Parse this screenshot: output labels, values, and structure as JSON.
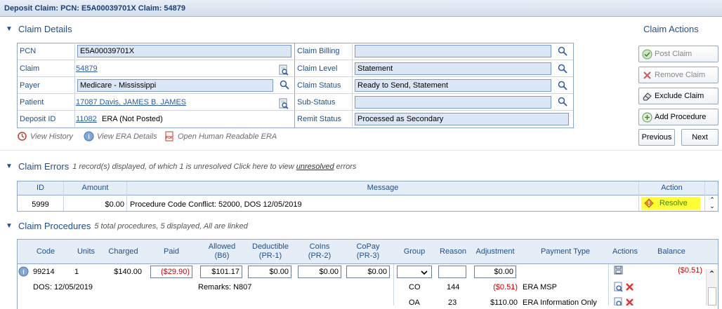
{
  "title": "Deposit Claim: PCN: E5A00039701X Claim: 54879",
  "claim_details": {
    "heading": "Claim Details",
    "left_rows": [
      {
        "label": "PCN",
        "value": "E5A00039701X"
      },
      {
        "label": "Claim",
        "value": "54879"
      },
      {
        "label": "Payer",
        "value": "Medicare - Mississippi"
      },
      {
        "label": "Patient",
        "value": "17087 Davis, JAMES B. JAMES"
      },
      {
        "label": "Deposit ID",
        "value": "11082",
        "extra": "ERA (Not Posted)"
      }
    ],
    "right_rows": [
      {
        "label": "Claim Billing",
        "value": ""
      },
      {
        "label": "Claim Level",
        "value": "Statement"
      },
      {
        "label": "Claim Status",
        "value": "Ready to Send, Statement"
      },
      {
        "label": "Sub-Status",
        "value": ""
      },
      {
        "label": "Remit Status",
        "value": "Processed as Secondary"
      }
    ],
    "links": {
      "view_history": "View History",
      "view_era": "View ERA Details",
      "open_era": "Open Human Readable ERA"
    }
  },
  "claim_actions": {
    "heading": "Claim Actions",
    "post": "Post Claim",
    "remove": "Remove Claim",
    "exclude": "Exclude Claim",
    "add_procedure": "Add Procedure",
    "previous": "Previous",
    "next": "Next"
  },
  "claim_errors": {
    "heading": "Claim Errors",
    "summary_pre": "1 record(s) displayed, of which 1 is unresolved Click here to view",
    "summary_link": "unresolved",
    "summary_post": "errors",
    "columns": {
      "id": "ID",
      "amount": "Amount",
      "message": "Message",
      "action": "Action"
    },
    "row": {
      "id": "5999",
      "amount": "$0.00",
      "message": "Procedure Code Conflict: 52000, DOS 12/05/2019",
      "action": "Resolve"
    }
  },
  "claim_procedures": {
    "heading": "Claim Procedures",
    "summary": "5 total procedures, 5 displayed, All are linked",
    "columns": {
      "code": "Code",
      "units": "Units",
      "charged": "Charged",
      "paid": "Paid",
      "allowed": "Allowed",
      "allowed_sub": "(B6)",
      "deductible": "Deductible",
      "deductible_sub": "(PR-1)",
      "coins": "CoIns",
      "coins_sub": "(PR-2)",
      "copay": "CoPay",
      "copay_sub": "(PR-3)",
      "group": "Group",
      "reason": "Reason",
      "adjustment": "Adjustment",
      "payment_type": "Payment Type",
      "actions": "Actions",
      "balance": "Balance"
    },
    "row": {
      "code": "99214",
      "units": "1",
      "charged": "$140.00",
      "paid": "($29.90)",
      "allowed": "$101.17",
      "deductible": "$0.00",
      "coins": "$0.00",
      "copay": "$0.00",
      "group": "",
      "reason": "",
      "adjustment": "$0.00",
      "balance": "($0.51)",
      "dos": "DOS: 12/05/2019",
      "remarks": "Remarks: N807",
      "adjustments": [
        {
          "group": "CO",
          "reason": "144",
          "amount": "($0.51)",
          "type": "ERA MSP"
        },
        {
          "group": "OA",
          "reason": "23",
          "amount": "$110.00",
          "type": "ERA Information Only"
        }
      ]
    }
  }
}
